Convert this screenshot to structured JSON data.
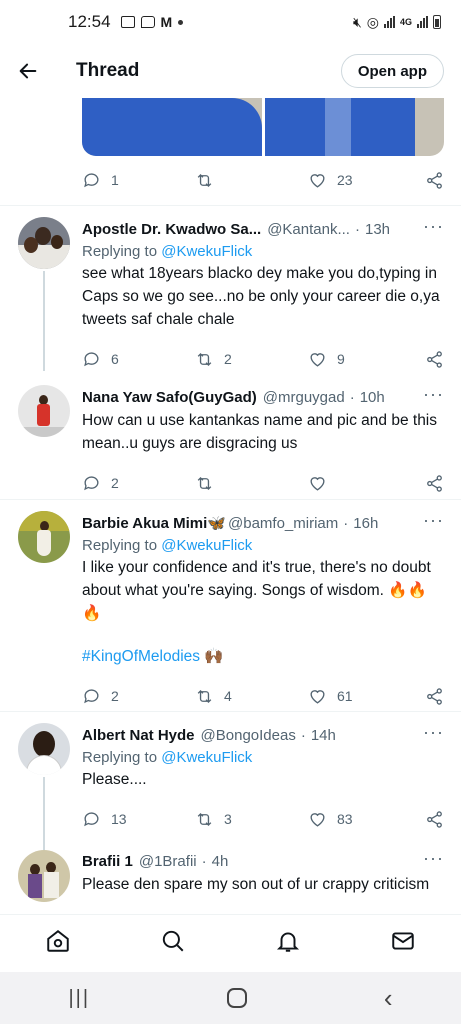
{
  "status_bar": {
    "time": "12:54",
    "network": "4G"
  },
  "header": {
    "title": "Thread",
    "open_app": "Open app"
  },
  "top_actions": {
    "replies": "1",
    "retweets": "",
    "likes": "23"
  },
  "tweets": [
    {
      "name": "Apostle Dr. Kwadwo Sa...",
      "handle": "@Kantank...",
      "time": "13h",
      "replying_prefix": "Replying to ",
      "replying_to": "@KwekuFlick",
      "text": "see what 18years blacko dey make you do,typing in Caps so we go see...no be only your career die o,ya tweets saf chale chale",
      "replies": "6",
      "retweets": "2",
      "likes": "9"
    },
    {
      "name": "Nana Yaw Safo(GuyGad)",
      "handle": "@mrguygad",
      "time": "10h",
      "text": "How can u use kantankas name and pic and be this mean..u guys are disgracing us",
      "replies": "2",
      "retweets": "",
      "likes": ""
    },
    {
      "name": "Barbie Akua Mimi",
      "name_emoji": "🦋",
      "handle": "@bamfo_miriam",
      "time": "16h",
      "replying_prefix": "Replying to ",
      "replying_to": "@KwekuFlick",
      "text": "I like your confidence and it's true, there's no doubt about what you're saying. Songs of wisdom. 🔥🔥🔥",
      "hashtag": "#KingOfMelodies",
      "hashtag_emoji": "🙌🏾",
      "replies": "2",
      "retweets": "4",
      "likes": "61"
    },
    {
      "name": "Albert Nat Hyde",
      "handle": "@BongoIdeas",
      "time": "14h",
      "replying_prefix": "Replying to ",
      "replying_to": "@KwekuFlick",
      "text": "Please....",
      "replies": "13",
      "retweets": "3",
      "likes": "83"
    },
    {
      "name": "Brafii 1",
      "handle": "@1Brafii",
      "time": "4h",
      "text": "Please den spare my son out of ur crappy criticism"
    }
  ],
  "separator": "·",
  "more": "···",
  "bottom_nav": [
    "home-icon",
    "search-icon",
    "notifications-icon",
    "messages-icon"
  ],
  "colors": {
    "link": "#1d9bf0",
    "muted": "#536471",
    "text": "#0f1419"
  }
}
